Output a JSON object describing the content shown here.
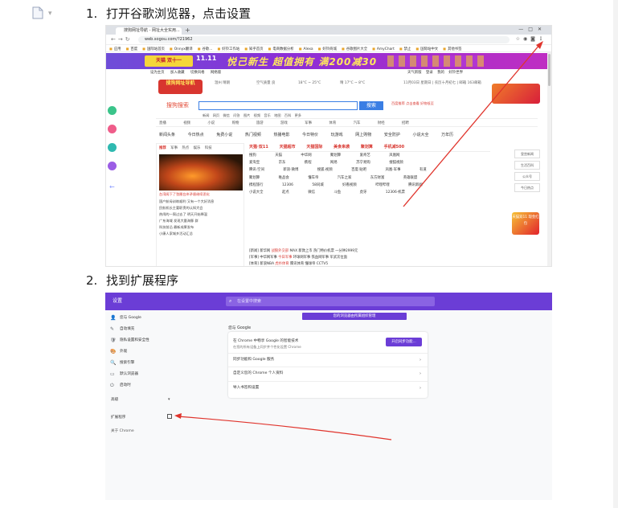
{
  "document": {
    "step1": {
      "num": "1.",
      "text": "打开谷歌浏览器，点击设置"
    },
    "step2": {
      "num": "2.",
      "text": "找到扩展程序"
    }
  },
  "browser": {
    "tab_title": "搜狗网址导航 - 网址大全实用...",
    "url": "web.sogou.com/?21962",
    "bookmarks": [
      "应用",
      "百度",
      "国际站首页",
      "Onnyx翻译",
      "谷歌...",
      "好铃工作站",
      "知乎首页",
      "电商数据分析",
      "Alexa",
      "好铃商城",
      "谷歌图片大全",
      "AmyChart",
      "禁止",
      "国际站中文",
      "其他书签"
    ],
    "banner": {
      "brand": "天猫 双十一",
      "count": "11.11",
      "slogan": "悦己新生 超值拥有 满200减30"
    },
    "subnav": [
      "设为主页",
      "加入收藏",
      "切换风格",
      "网络版"
    ],
    "subnav_right": [
      "天气新版",
      "登录",
      "我的",
      "好铃世界"
    ],
    "logo_text": "搜狗网址导航",
    "weather": [
      "温州 晴朗",
      "空气质量 良",
      "18°C ~ 25°C",
      "晴 17°C ~ 8°C"
    ],
    "weather_right": "11月03日 星期日 | 农历十月初七 | 邮箱 163邮箱",
    "search_logo": "搜狗搜索",
    "search_button": "搜索",
    "search_ad": "百度推荐 点击查看 好物低至",
    "search_tags": [
      "新闻",
      "网页",
      "微信",
      "问答",
      "图片",
      "视频",
      "音乐",
      "地图",
      "百科",
      "更多"
    ],
    "categories": [
      "直播",
      "视频",
      "小说",
      "购物",
      "旅游",
      "游戏",
      "军事",
      "体育",
      "汽车",
      "财经",
      "招聘"
    ],
    "quick_links": [
      "新闻头条",
      "今日热点",
      "免费小说",
      "热门视频",
      "热播电影",
      "今日特价",
      "玩游戏",
      "网上购物",
      "安全防护",
      "小说大全",
      "万年历"
    ],
    "left_panel": {
      "tabs": [
        "推荐",
        "军事",
        "热点",
        "娱乐",
        "科技"
      ],
      "caption": "台湾阁下了弦圈台岸矛盾继续恶化",
      "news": [
        "国产航母训练顺利 又有一个大好消息",
        "民航机长主要职责的认知大会",
        "热闹的一周过去了 明天开始降温",
        "广东海域 发现大量海豚 群",
        "科技前沿 最新成果发布",
        "小康人家城乡活动汇总"
      ]
    },
    "grid": {
      "head": [
        "天猫·双11",
        "天猫超市",
        "天猫国际",
        "美食来袭",
        "聚划算",
        "手机减500"
      ],
      "rows": [
        [
          "搜狗",
          "天猫",
          "中华网",
          "聚划算",
          "爱奇艺",
          "凤凰网"
        ],
        [
          "爱淘宝",
          "京东",
          "携程",
          "网易",
          "苏宁易购",
          "搜狐视频"
        ],
        [
          "腾讯·空间",
          "新浪·微博",
          "搜狐·视频",
          "百度·贴吧",
          "凤凰·军事",
          "有道"
        ],
        [
          "聚划算",
          "唯品会",
          "懂车帝",
          "汽车之家",
          "东方财富",
          "英雄联盟"
        ],
        [
          "携程旅行",
          "12306",
          "58同城",
          "好看视频",
          "哔哩哔哩",
          "腾讯新闻"
        ],
        [
          "小说大全",
          "起点",
          "微信",
          "斗鱼",
          "虎牙",
          "12306·机票"
        ]
      ]
    },
    "news_list": [
      [
        "[新闻]",
        "新华网",
        "战狼外交部",
        "MAX 新款上市",
        "热门特价机票",
        "一分钟2999元"
      ],
      [
        "[军事]",
        "中华网军事",
        "今日军事",
        "环球网军事",
        "铁血网军事",
        "军武次位面"
      ],
      [
        "[体育]",
        "新浪NBA",
        "虎扑体育",
        "腾讯体育",
        "懂球帝",
        "CCTV5"
      ]
    ],
    "right_col": [
      "皇宫新闻",
      "生活百科",
      "公众号",
      "今日热点"
    ],
    "right_promo": "天猫双11 现金红包"
  },
  "settings": {
    "title": "设置",
    "search_placeholder": "在设置中搜索",
    "sidebar": [
      "您与 Google",
      "自动填充",
      "隐私设置和安全性",
      "外观",
      "搜索引擎",
      "默认浏览器",
      "启动时"
    ],
    "advanced": "高级",
    "extensions": "扩展程序",
    "about": "关于 Chrome",
    "banner": "您的浏览器由所属组织管理",
    "section": "您与 Google",
    "card": {
      "main": "在 Chrome 中畅享 Google 的智能技术",
      "sub": "在您的所有设备上同步并个性化设置 Chrome",
      "button": "开启同步功能..."
    },
    "rows": [
      "同步功能和 Google 服务",
      "自定义您的 Chrome 个人资料",
      "导入书签和设置"
    ]
  },
  "colors": {
    "accent_purple": "#6b3dd6",
    "annotation_red": "#e0342c",
    "sogou_red": "#d8362f",
    "link_blue": "#3a7ee4"
  }
}
